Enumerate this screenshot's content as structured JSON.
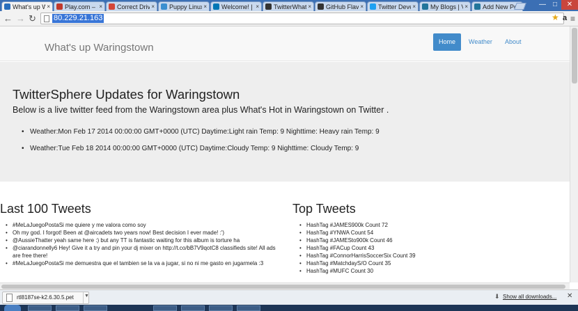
{
  "browser": {
    "tabs": [
      {
        "label": "What's up W",
        "icon": "waringstown-icon",
        "color": "#2a6fbd",
        "active": true
      },
      {
        "label": "Play.com – (",
        "icon": "play-icon",
        "color": "#c0392b",
        "active": false
      },
      {
        "label": "Correct Driv",
        "icon": "gmail-icon",
        "color": "#d44638",
        "active": false
      },
      {
        "label": "Puppy Linux",
        "icon": "puppy-icon",
        "color": "#3a8fd0",
        "active": false
      },
      {
        "label": "Welcome! | l",
        "icon": "linkedin-icon",
        "color": "#0077b5",
        "active": false
      },
      {
        "label": "TwitterWhat",
        "icon": "github-icon",
        "color": "#333333",
        "active": false
      },
      {
        "label": "GitHub Flavo",
        "icon": "github-icon",
        "color": "#333333",
        "active": false
      },
      {
        "label": "Twitter Deve",
        "icon": "twitter-icon",
        "color": "#1da1f2",
        "active": false
      },
      {
        "label": "My Blogs | V",
        "icon": "wordpress-icon",
        "color": "#21759b",
        "active": false
      },
      {
        "label": "Add New Po",
        "icon": "wordpress-icon",
        "color": "#21759b",
        "active": false
      }
    ],
    "url": "80.229.21.163"
  },
  "navbar": {
    "brand": "What's up Waringstown",
    "items": [
      "Home",
      "Weather",
      "About"
    ]
  },
  "jumbotron": {
    "title": "TwitterSphere Updates for Waringstown",
    "subtitle": "Below is a live twitter feed from the Waringstown area plus What's Hot in Waringstown on Twitter .",
    "weather": [
      "Weather:Mon Feb 17 2014 00:00:00 GMT+0000 (UTC) Daytime:Light rain Temp: 9 Nighttime: Heavy rain Temp: 9",
      "Weather:Tue Feb 18 2014 00:00:00 GMT+0000 (UTC) Daytime:Cloudy Temp: 9 Nighttime: Cloudy Temp: 9"
    ]
  },
  "tweets": {
    "title": "Last 100 Tweets",
    "items": [
      "#MeLaJuegoPostaSi me quiere y me valora como soy",
      "Oh my god. I forgot! Been at @aircadets two years now! Best decision I ever made! :')",
      "@AussieThatter yeah same here :) but any TT is fantastic waiting for this album is torture ha",
      "@ciarandonnelly6 Hey! Give it a try and pin your dj mixer on http://t.co/bB7V9qotC8 classifieds site! All ads are free there!",
      "#MeLaJuegoPostaSi me demuestra que el tambien se la va a jugar, si no ni me gasto en jugarmela :3"
    ]
  },
  "top_tweets": {
    "title": "Top Tweets",
    "items": [
      "HashTag #JAMES900k Count 72",
      "HashTag #YNWA Count 54",
      "HashTag #JAMESto900k Count 46",
      "HashTag #FACup Count 43",
      "HashTag #ConnorHarrisSoccerSix Count 39",
      "HashTag #MatchdayS/O Count 35",
      "HashTag #MUFC Count 30"
    ]
  },
  "downloads": {
    "file": "rtl8187se-k2.6.30.5.pet",
    "show_all": "Show all downloads..."
  }
}
